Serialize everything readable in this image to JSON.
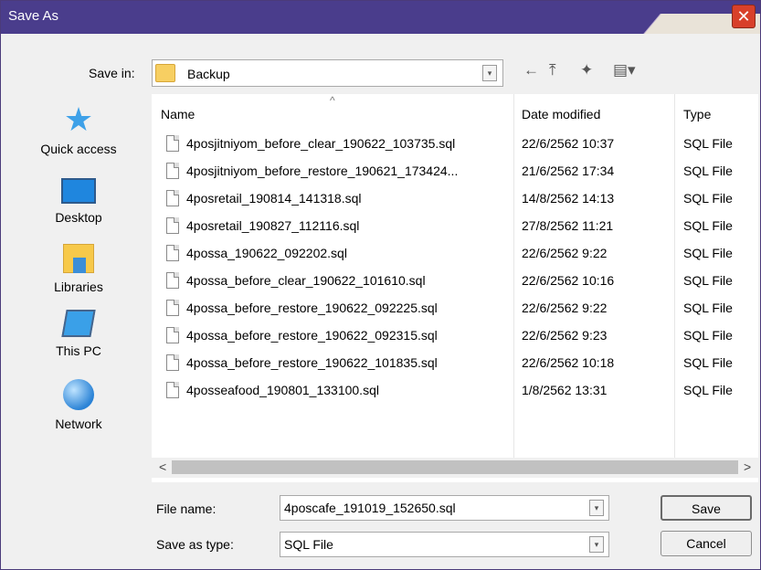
{
  "window": {
    "title": "Save As",
    "close_glyph": "✕"
  },
  "save_in": {
    "label": "Save in:",
    "folder": "Backup"
  },
  "toolbar": [
    {
      "name": "back-icon",
      "glyph": "←"
    },
    {
      "name": "up-folder-icon",
      "glyph": "⤒"
    },
    {
      "name": "new-folder-icon",
      "glyph": "✦"
    },
    {
      "name": "view-menu-icon",
      "glyph": "▤▾"
    }
  ],
  "places": [
    {
      "label": "Quick access",
      "icon": "quick-access-icon"
    },
    {
      "label": "Desktop",
      "icon": "desktop-icon"
    },
    {
      "label": "Libraries",
      "icon": "libraries-icon"
    },
    {
      "label": "This PC",
      "icon": "this-pc-icon"
    },
    {
      "label": "Network",
      "icon": "network-icon"
    }
  ],
  "columns": {
    "name": "Name",
    "date": "Date modified",
    "type": "Type",
    "sort_glyph": "^"
  },
  "files": [
    {
      "name": "4posjitniyom_before_clear_190622_103735.sql",
      "date": "22/6/2562 10:37",
      "type": "SQL File"
    },
    {
      "name": "4posjitniyom_before_restore_190621_173424...",
      "date": "21/6/2562 17:34",
      "type": "SQL File"
    },
    {
      "name": "4posretail_190814_141318.sql",
      "date": "14/8/2562 14:13",
      "type": "SQL File"
    },
    {
      "name": "4posretail_190827_112116.sql",
      "date": "27/8/2562 11:21",
      "type": "SQL File"
    },
    {
      "name": "4possa_190622_092202.sql",
      "date": "22/6/2562 9:22",
      "type": "SQL File"
    },
    {
      "name": "4possa_before_clear_190622_101610.sql",
      "date": "22/6/2562 10:16",
      "type": "SQL File"
    },
    {
      "name": "4possa_before_restore_190622_092225.sql",
      "date": "22/6/2562 9:22",
      "type": "SQL File"
    },
    {
      "name": "4possa_before_restore_190622_092315.sql",
      "date": "22/6/2562 9:23",
      "type": "SQL File"
    },
    {
      "name": "4possa_before_restore_190622_101835.sql",
      "date": "22/6/2562 10:18",
      "type": "SQL File"
    },
    {
      "name": "4posseafood_190801_133100.sql",
      "date": "1/8/2562 13:31",
      "type": "SQL File"
    }
  ],
  "scroll": {
    "left_glyph": "<",
    "right_glyph": ">"
  },
  "file_name": {
    "label": "File name:",
    "value": "4poscafe_191019_152650.sql"
  },
  "save_as_type": {
    "label": "Save as type:",
    "value": "SQL File"
  },
  "buttons": {
    "save": "Save",
    "cancel": "Cancel"
  },
  "dropdown_glyph": "▾"
}
